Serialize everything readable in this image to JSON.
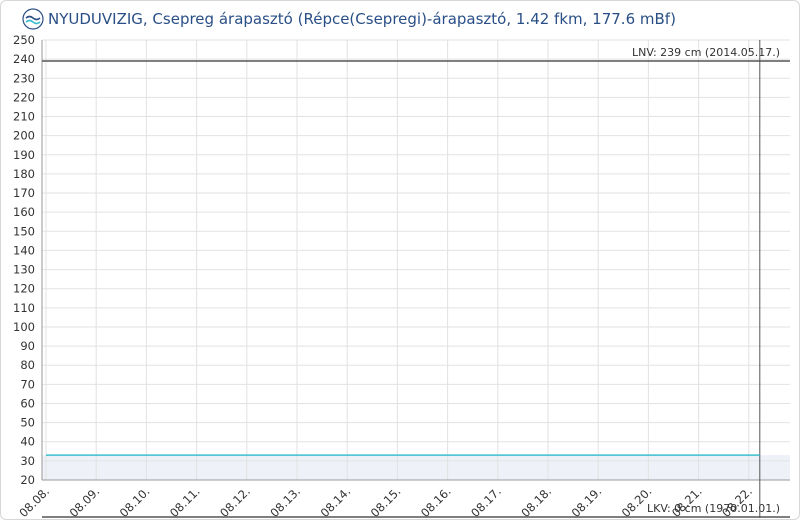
{
  "header": {
    "title": "NYUDUVIZIG, Csepreg árapasztó (Répce(Csepregi)-árapasztó, 1.42 fkm, 177.6 mBf)",
    "logo_icon": "water-directorate-logo"
  },
  "colors": {
    "series": "#3bbfcf",
    "grid": "#e2e2e2",
    "reference": "#555555",
    "plot_bg": "#ffffff",
    "band_bg": "#eef1f8",
    "title": "#2a4f86"
  },
  "chart_data": {
    "type": "line",
    "title": "NYUDUVIZIG, Csepreg árapasztó (Répce(Csepregi)-árapasztó, 1.42 fkm, 177.6 mBf)",
    "xlabel": "",
    "ylabel": "",
    "ylim": [
      20,
      250
    ],
    "yticks": [
      20,
      30,
      40,
      50,
      60,
      70,
      80,
      90,
      100,
      110,
      120,
      130,
      140,
      150,
      160,
      170,
      180,
      190,
      200,
      210,
      220,
      230,
      240,
      250
    ],
    "categories": [
      "08.08.",
      "08.09.",
      "08.10.",
      "08.11.",
      "08.12.",
      "08.13.",
      "08.14.",
      "08.15.",
      "08.16.",
      "08.17.",
      "08.18.",
      "08.19.",
      "08.20.",
      "08.21.",
      "08.22."
    ],
    "series": [
      {
        "x": [
          "08.08.",
          "08.22."
        ],
        "values": [
          33,
          33
        ]
      }
    ],
    "reference_lines": [
      {
        "label": "LNV: 239 cm (2014.05.17.)",
        "value": 239
      },
      {
        "label": "LKV: 0 cm (1970.01.01.)",
        "value": 0
      }
    ],
    "current_marker": "08.22.",
    "grid": true,
    "legend": "none"
  }
}
